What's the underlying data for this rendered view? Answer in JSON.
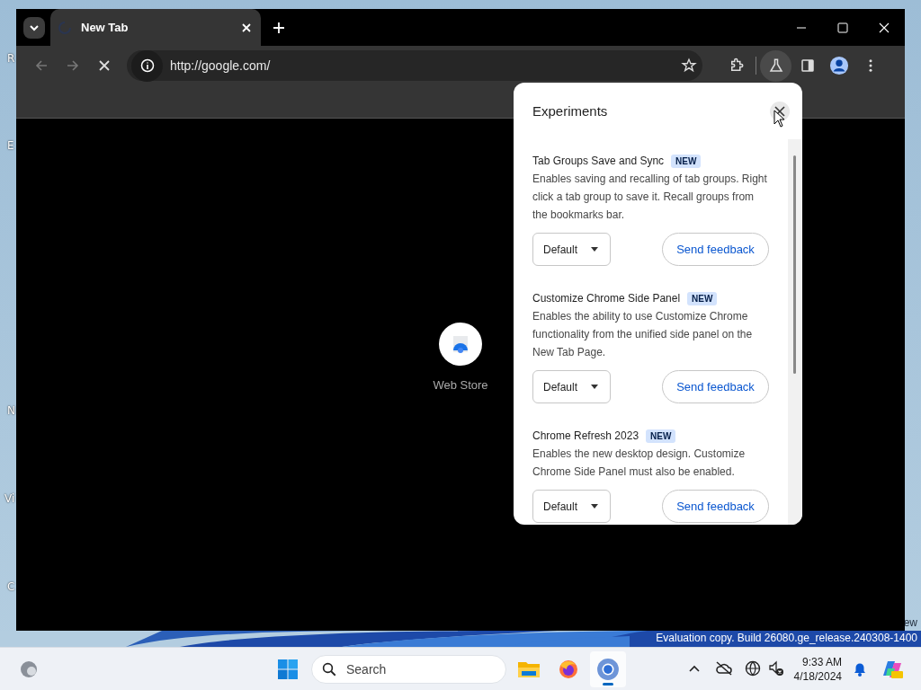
{
  "desktop": {
    "icon_labels": [
      "R",
      "E",
      "N",
      "Vi",
      "C"
    ],
    "watermark": [
      "ew",
      "Evaluation copy. Build 26080.ge_release.240308-1400"
    ]
  },
  "browser": {
    "tabs": [
      {
        "title": "New Tab",
        "selected": true,
        "loading": true
      }
    ],
    "loading": true,
    "address": "http://google.com/",
    "shortcuts": [
      {
        "label": "Web Store"
      }
    ]
  },
  "experiments_panel": {
    "title": "Experiments",
    "items": [
      {
        "name": "Tab Groups Save and Sync",
        "badge": "NEW",
        "description": "Enables saving and recalling of tab groups. Right click a tab group to save it. Recall groups from the bookmarks bar.",
        "option": "Default",
        "button": "Send feedback"
      },
      {
        "name": "Customize Chrome Side Panel",
        "badge": "NEW",
        "description": "Enables the ability to use Customize Chrome functionality from the unified side panel on the New Tab Page.",
        "option": "Default",
        "button": "Send feedback"
      },
      {
        "name": "Chrome Refresh 2023",
        "badge": "NEW",
        "description": "Enables the new desktop design. Customize Chrome Side Panel must also be enabled.",
        "option": "Default",
        "button": "Send feedback"
      }
    ]
  },
  "taskbar": {
    "search_placeholder": "Search",
    "apps": [
      {
        "kind": "files",
        "selected": false
      },
      {
        "kind": "firefox",
        "selected": false
      },
      {
        "kind": "chrome",
        "selected": true
      }
    ],
    "time": "9:33 AM",
    "date": "4/18/2024"
  }
}
